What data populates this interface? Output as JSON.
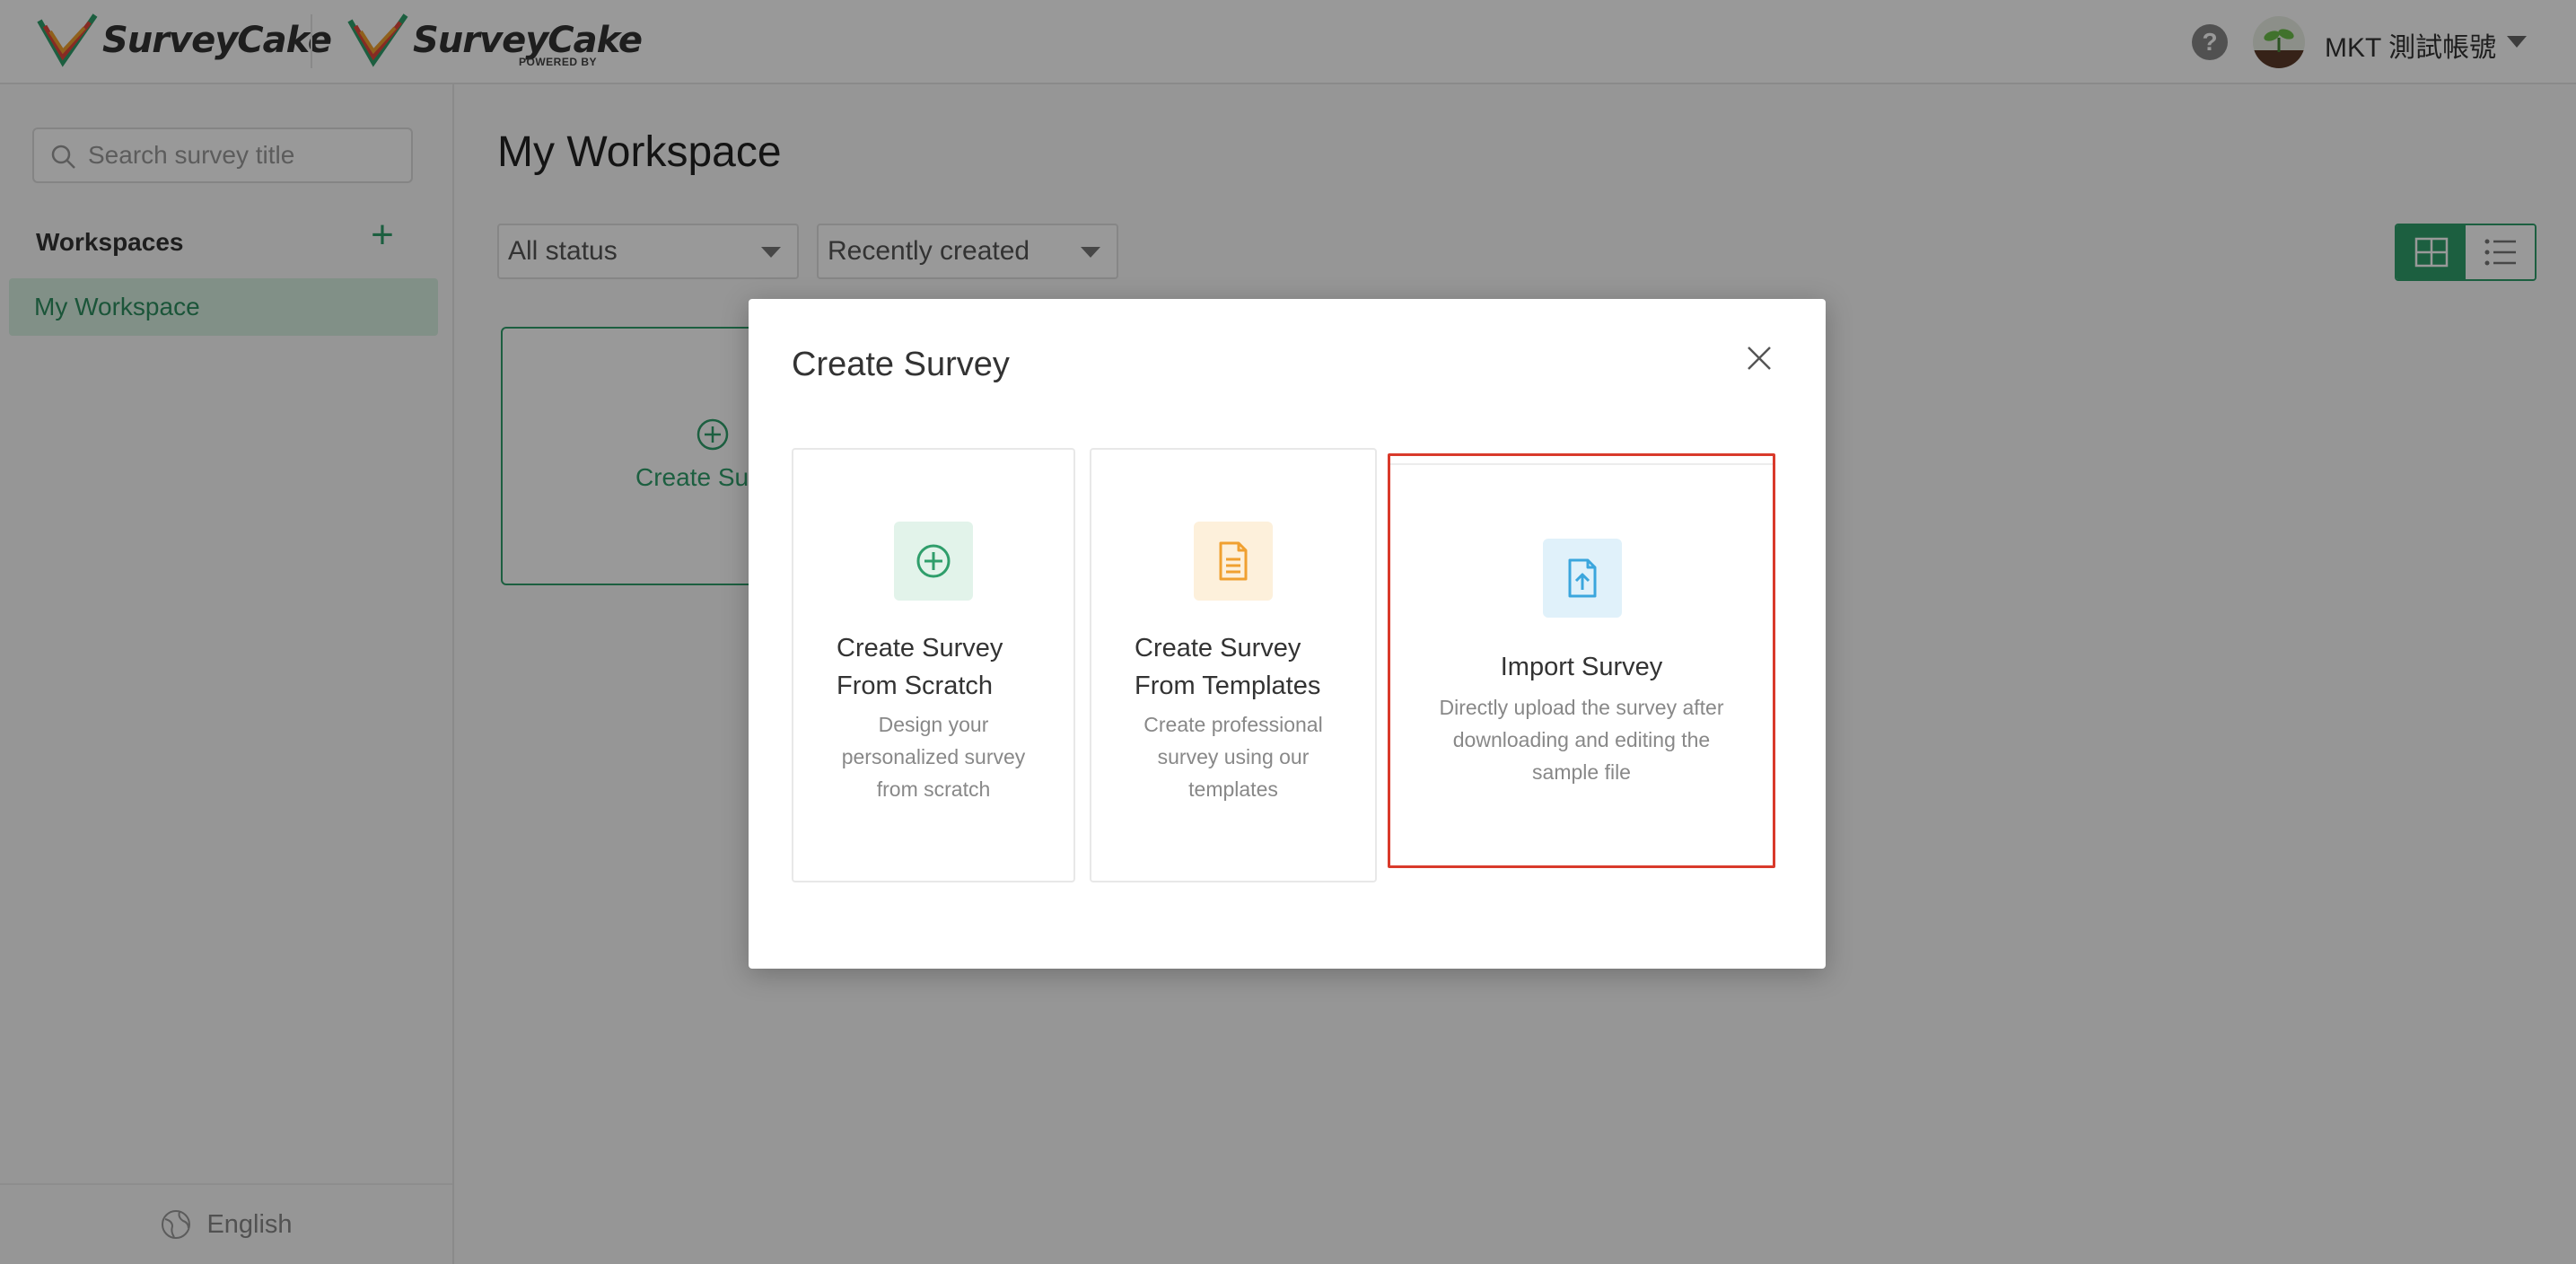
{
  "header": {
    "logo_text": "SurveyCake",
    "logo_text_2": "SurveyCake",
    "powered_by": "POWERED BY",
    "help_glyph": "?",
    "user_name": "MKT 測試帳號"
  },
  "sidebar": {
    "search_placeholder": "Search survey title",
    "workspaces_heading": "Workspaces",
    "add_glyph": "+",
    "items": [
      {
        "label": "My Workspace",
        "active": true
      }
    ],
    "language": "English"
  },
  "main": {
    "title": "My Workspace",
    "status_filter": "All status",
    "sort_filter": "Recently created",
    "create_card_label": "Create Survey"
  },
  "modal": {
    "title": "Create Survey",
    "options": [
      {
        "title_line1": "Create Survey",
        "title_line2": "From Scratch",
        "description": "Design your personalized survey from scratch",
        "icon": "plus-circle-icon",
        "color": "#2f9e6b"
      },
      {
        "title_line1": "Create Survey",
        "title_line2": "From Templates",
        "description": "Create professional survey using our templates",
        "icon": "document-icon",
        "color": "#f0a030"
      },
      {
        "title": "Import Survey",
        "description": "Directly upload the survey after downloading and editing the sample file",
        "icon": "file-upload-icon",
        "color": "#3ba6dd",
        "highlighted": true
      }
    ]
  },
  "colors": {
    "brand_green": "#2f9e6b",
    "highlight_red": "#d93a2b",
    "overlay": "rgba(0,0,0,0.4)"
  }
}
